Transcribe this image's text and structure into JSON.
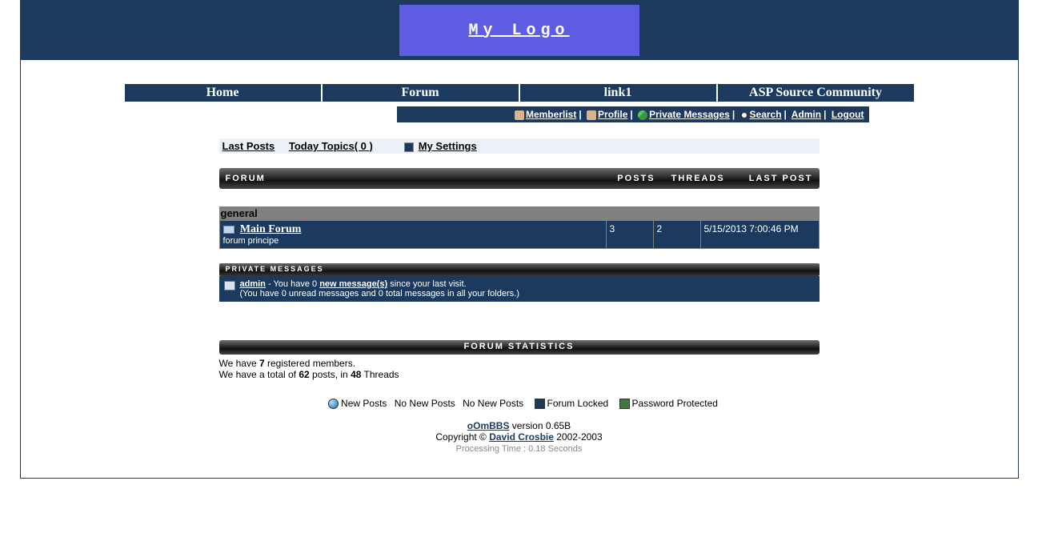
{
  "logo": {
    "text": "My Logo"
  },
  "nav": [
    {
      "label": "Home"
    },
    {
      "label": "Forum"
    },
    {
      "label": "link1"
    },
    {
      "label": "ASP Source Community"
    }
  ],
  "userbar": {
    "memberlist": "Memberlist",
    "profile": "Profile",
    "pm": "Private Messages",
    "search": "Search",
    "admin": "Admin",
    "logout": "Logout"
  },
  "quick": {
    "last_posts": "Last Posts",
    "today_topics": "Today Topics( 0 )",
    "my_settings": "My Settings"
  },
  "forum_header": {
    "forum": "FORUM",
    "posts": "POSTS",
    "threads": "THREADS",
    "last_post": "LAST POST"
  },
  "category_name": "general",
  "main_forum": {
    "name": "Main Forum",
    "desc": "forum principe",
    "posts": "3",
    "threads": "2",
    "last_post": "5/15/2013 7:00:46 PM"
  },
  "pm_section": {
    "title": "PRIVATE MESSAGES",
    "user": "admin",
    "line1a": " - You have 0 ",
    "new_messages": "new message(s)",
    "line1b": " since your last visit.",
    "line2": "(You have 0 unread messages and 0 total messages in all your folders.)"
  },
  "stats": {
    "title": "FORUM STATISTICS",
    "members_intro": "We have ",
    "members_count": "7",
    "members_outro": " registered members.",
    "posts_intro": "We have a total of ",
    "posts_count": "62",
    "posts_mid": " posts, in ",
    "threads_count": "48",
    "posts_outro": " Threads"
  },
  "legend": {
    "new_posts": "New Posts",
    "no_new1": "No New Posts",
    "no_new2": "No New Posts",
    "locked": "Forum Locked",
    "pw": "Password Protected"
  },
  "footer": {
    "product": "oOmBBS",
    "version": " version 0.65B",
    "copyright": "Copyright © ",
    "author": "David Crosbie",
    "years": " 2002-2003",
    "processing": "Processing Time : 0.18 Seconds"
  }
}
